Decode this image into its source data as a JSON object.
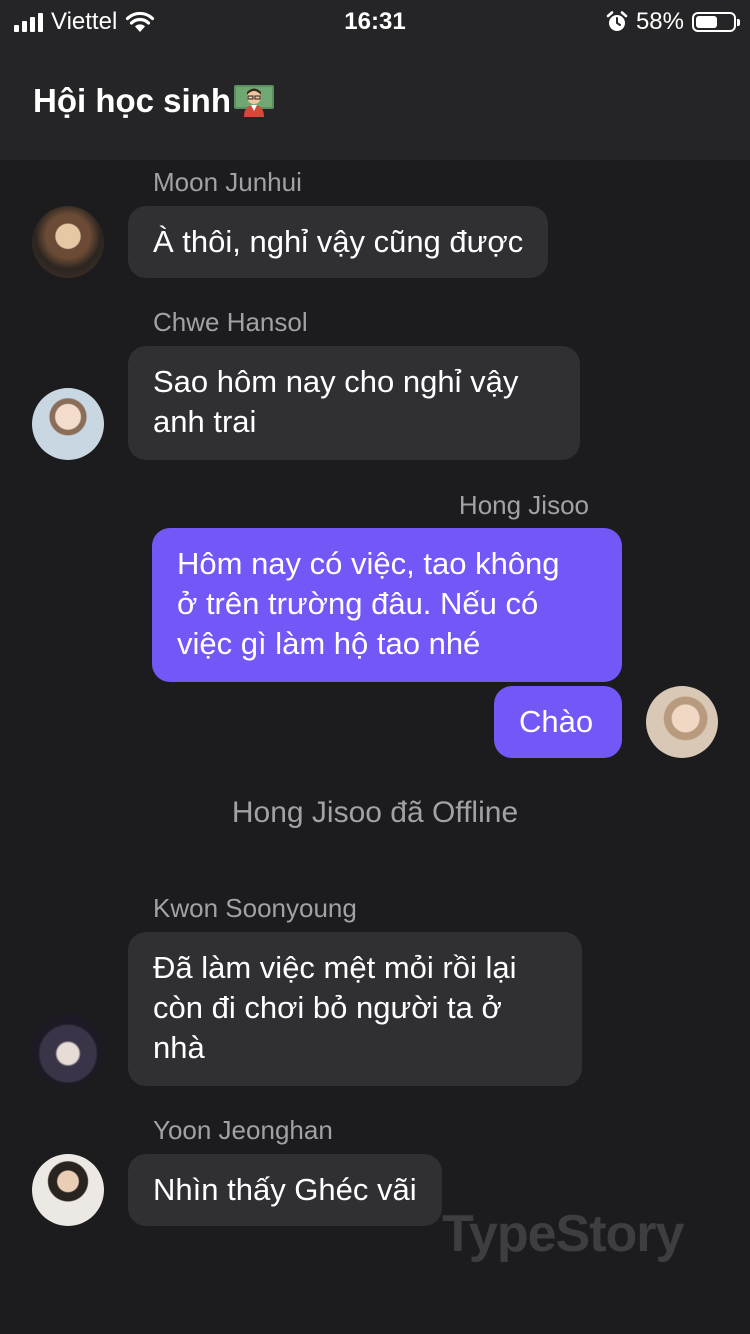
{
  "status_bar": {
    "carrier": "Viettel",
    "time": "16:31",
    "battery_percent": "58%",
    "battery_level": 0.58,
    "icons": [
      "signal-icon",
      "wifi-icon",
      "alarm-icon",
      "battery-icon"
    ]
  },
  "header": {
    "title": "Hội học sinh",
    "title_icon": "teacher-emoji-icon"
  },
  "messages": [
    {
      "sender": "Moon Junhui",
      "text": "À thôi, nghỉ vậy cũng được",
      "direction": "incoming"
    },
    {
      "sender": "Chwe Hansol",
      "text": "Sao hôm nay cho nghỉ vậy\nanh trai",
      "direction": "incoming"
    },
    {
      "sender": "Hong Jisoo",
      "text": "Hôm nay có việc, tao không\nở trên trường đâu. Nếu có\nviệc gì làm hộ tao nhé",
      "direction": "outgoing"
    },
    {
      "sender": "",
      "text": "Chào",
      "direction": "outgoing"
    },
    {
      "sender": "Kwon Soonyoung",
      "text": "Đã làm việc mệt mỏi rồi lại\ncòn đi chơi bỏ người ta ở\nnhà",
      "direction": "incoming"
    },
    {
      "sender": "Yoon Jeonghan",
      "text": "Nhìn thấy Ghéc vãi",
      "direction": "incoming"
    }
  ],
  "system_message": "Hong Jisoo đã Offline",
  "watermark": "TypeStory",
  "colors": {
    "background": "#1c1c1e",
    "header": "#252527",
    "incoming_bubble": "#303034",
    "outgoing_bubble": "#7457f7",
    "muted_text": "#a1a1a6"
  }
}
